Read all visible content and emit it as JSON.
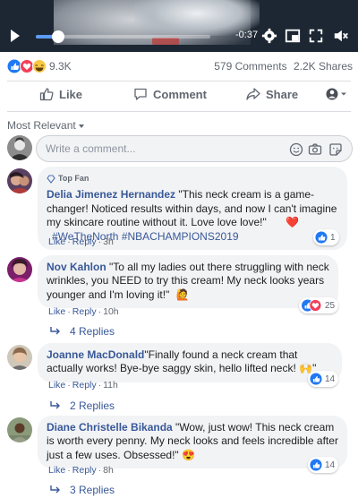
{
  "video": {
    "time_remaining": "-0:37",
    "progress": 0.13
  },
  "post_stats": {
    "reaction_count": "9.3K",
    "comments": "579 Comments",
    "shares": "2.2K Shares"
  },
  "actions": {
    "like": "Like",
    "comment": "Comment",
    "share": "Share"
  },
  "sort": {
    "label": "Most Relevant"
  },
  "composer": {
    "placeholder": "Write a comment..."
  },
  "colors": {
    "link": "#385898",
    "bubble": "#f2f3f5",
    "like_blue": "#2078f4",
    "love_red": "#f33e58"
  },
  "comments": [
    {
      "badge": "Top Fan",
      "author": "Delia Jimenez Hernandez",
      "text": " \"This neck cream is a game-changer! Noticed results within days, and now I can't imagine my skincare routine without it. Love love love!\"",
      "emoji": "❤️",
      "hashtag1": "#WeTheNorth",
      "hashtag2": "#NBACHAMPIONS2019",
      "like": "Like",
      "reply": "Reply",
      "time": "3h",
      "reactions": "1"
    },
    {
      "author": "Nov Kahlon",
      "text": " \"To all my ladies out there struggling with neck wrinkles, you NEED to try this cream! My neck looks years younger and I'm loving it!\"",
      "emoji": "🙋",
      "like": "Like",
      "reply": "Reply",
      "time": "10h",
      "reactions": "25",
      "replies": "4 Replies"
    },
    {
      "author": "Joanne MacDonald",
      "text": "\"Finally found a neck cream that actually works! Bye-bye saggy skin, hello lifted neck!",
      "emoji": "🙌",
      "text_end": "\"",
      "like": "Like",
      "reply": "Reply",
      "time": "11h",
      "reactions": "14",
      "replies": "2 Replies"
    },
    {
      "author": "Diane Christelle Bikanda",
      "text": " \"Wow, just wow! This neck cream is worth every penny. My neck looks and feels incredible after just a few uses. Obsessed!\"",
      "emoji": "😍",
      "like": "Like",
      "reply": "Reply",
      "time": "8h",
      "reactions": "14",
      "replies": "3 Replies"
    }
  ]
}
